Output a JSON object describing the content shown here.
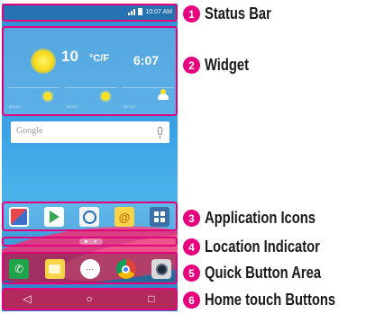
{
  "status_bar": {
    "time": "10:07 AM"
  },
  "widget": {
    "temperature": "10",
    "unit": "°C/F",
    "time": "6:07",
    "forecast": [
      {
        "label": "20°/12°",
        "icon": "sun-icon"
      },
      {
        "label": "19°/10°",
        "icon": "sun-icon"
      },
      {
        "label": "19°/11°",
        "icon": "partly-cloudy-icon"
      }
    ]
  },
  "search": {
    "placeholder": "Google"
  },
  "app_icons": [
    "contacts-icon",
    "play-store-icon",
    "people-icon",
    "email-icon",
    "apps-icon"
  ],
  "quick_buttons": [
    "phone-icon",
    "messaging-icon",
    "apps-drawer-icon",
    "chrome-icon",
    "camera-icon"
  ],
  "nav": {
    "back": "◁",
    "home": "○",
    "recent": "□"
  },
  "quick_apps_glyph": "⋯",
  "email_glyph": "@",
  "callouts": [
    {
      "num": "1",
      "label": "Status Bar"
    },
    {
      "num": "2",
      "label": "Widget"
    },
    {
      "num": "3",
      "label": "Application Icons"
    },
    {
      "num": "4",
      "label": "Location Indicator"
    },
    {
      "num": "5",
      "label": "Quick Button Area"
    },
    {
      "num": "6",
      "label": "Home touch Buttons"
    }
  ],
  "colors": {
    "accent": "#e6007e",
    "home_bar": "#b22a5c",
    "screen": "#3aa2e4"
  }
}
